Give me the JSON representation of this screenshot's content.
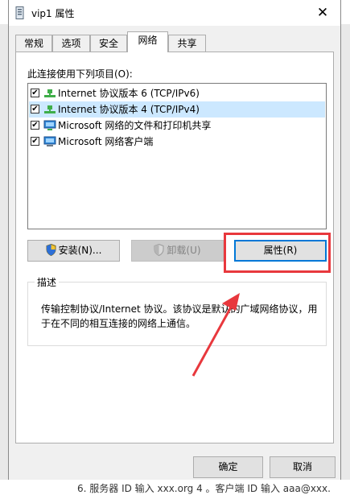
{
  "background": {
    "footer_text": "6. 服务器 ID 输入 xxx.org 4 。客户端 ID 输入 aaa@xxx."
  },
  "window": {
    "title": "vip1 属性",
    "close_glyph": "✕"
  },
  "tabs": [
    {
      "label": "常规",
      "active": false
    },
    {
      "label": "选项",
      "active": false
    },
    {
      "label": "安全",
      "active": false
    },
    {
      "label": "网络",
      "active": true
    },
    {
      "label": "共享",
      "active": false
    }
  ],
  "list": {
    "label": "此连接使用下列项目(O):",
    "items": [
      {
        "label": "Internet 协议版本 6 (TCP/IPv6)",
        "checked": true,
        "icon": "network-protocol-icon",
        "selected": false
      },
      {
        "label": "Internet 协议版本 4 (TCP/IPv4)",
        "checked": true,
        "icon": "network-protocol-icon",
        "selected": true
      },
      {
        "label": "Microsoft 网络的文件和打印机共享",
        "checked": true,
        "icon": "network-service-icon",
        "selected": false
      },
      {
        "label": "Microsoft 网络客户端",
        "checked": true,
        "icon": "network-client-icon",
        "selected": false
      }
    ]
  },
  "buttons": {
    "install": "安装(N)...",
    "uninstall": "卸载(U)",
    "properties": "属性(R)"
  },
  "description": {
    "title": "描述",
    "text": "传输控制协议/Internet 协议。该协议是默认的广域网络协议，用于在不同的相互连接的网络上通信。"
  },
  "footer": {
    "ok": "确定",
    "cancel": "取消"
  },
  "colors": {
    "selection": "#cce8ff",
    "focus": "#0078d7",
    "annotation": "#e8383d"
  }
}
